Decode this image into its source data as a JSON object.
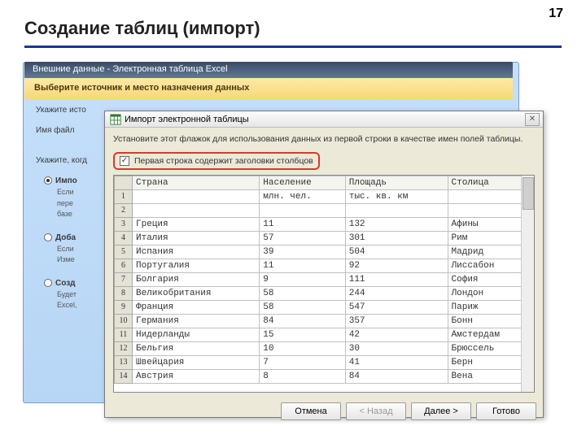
{
  "page": {
    "title": "Создание таблиц (импорт)",
    "number": "17"
  },
  "ribbon": {
    "title": "Внешние данные - Электронная таблица Excel"
  },
  "wizard_bg": {
    "header": "Выберите источник и место назначения данных",
    "line1": "Укажите исто",
    "line2": "Имя файл",
    "line3": "Укажите, когд",
    "opt1": "Импо",
    "opt1_sub1": "Если",
    "opt1_sub2": "пере",
    "opt1_sub3": "базе",
    "opt2": "Доба",
    "opt2_sub1": "Если",
    "opt2_sub2": "Изме",
    "opt3": "Созд",
    "opt3_sub1": "Будет",
    "opt3_sub2": "Excel,"
  },
  "dialog": {
    "title": "Импорт электронной таблицы",
    "instruction": "Установите этот флажок для использования данных из первой строки в качестве имен полей таблицы.",
    "checkbox_label": "Первая строка содержит заголовки столбцов",
    "columns": [
      "Страна",
      "Население",
      "Площадь",
      "Столица"
    ],
    "units_row": [
      "",
      "млн. чел.",
      "тыс. кв. км",
      ""
    ],
    "rows": [
      [
        "Греция",
        "11",
        "132",
        "Афины"
      ],
      [
        "Италия",
        "57",
        "301",
        "Рим"
      ],
      [
        "Испания",
        "39",
        "504",
        "Мадрид"
      ],
      [
        "Португалия",
        "11",
        "92",
        "Лиссабон"
      ],
      [
        "Болгария",
        "9",
        "111",
        "София"
      ],
      [
        "Великобритания",
        "58",
        "244",
        "Лондон"
      ],
      [
        "Франция",
        "58",
        "547",
        "Париж"
      ],
      [
        "Германия",
        "84",
        "357",
        "Бонн"
      ],
      [
        "Нидерланды",
        "15",
        "42",
        "Амстердам"
      ],
      [
        "Бельгия",
        "10",
        "30",
        "Брюссель"
      ],
      [
        "Швейцария",
        "7",
        "41",
        "Берн"
      ],
      [
        "Австрия",
        "8",
        "84",
        "Вена"
      ]
    ],
    "buttons": {
      "cancel": "Отмена",
      "back": "< Назад",
      "next": "Далее >",
      "finish": "Готово"
    }
  },
  "chart_data": {
    "type": "table",
    "title": "Импорт электронной таблицы",
    "columns": [
      "Страна",
      "Население (млн. чел.)",
      "Площадь (тыс. кв. км)",
      "Столица"
    ],
    "rows": [
      [
        "Греция",
        11,
        132,
        "Афины"
      ],
      [
        "Италия",
        57,
        301,
        "Рим"
      ],
      [
        "Испания",
        39,
        504,
        "Мадрид"
      ],
      [
        "Португалия",
        11,
        92,
        "Лиссабон"
      ],
      [
        "Болгария",
        9,
        111,
        "София"
      ],
      [
        "Великобритания",
        58,
        244,
        "Лондон"
      ],
      [
        "Франция",
        58,
        547,
        "Париж"
      ],
      [
        "Германия",
        84,
        357,
        "Бонн"
      ],
      [
        "Нидерланды",
        15,
        42,
        "Амстердам"
      ],
      [
        "Бельгия",
        10,
        30,
        "Брюссель"
      ],
      [
        "Швейцария",
        7,
        41,
        "Берн"
      ],
      [
        "Австрия",
        8,
        84,
        "Вена"
      ]
    ]
  }
}
